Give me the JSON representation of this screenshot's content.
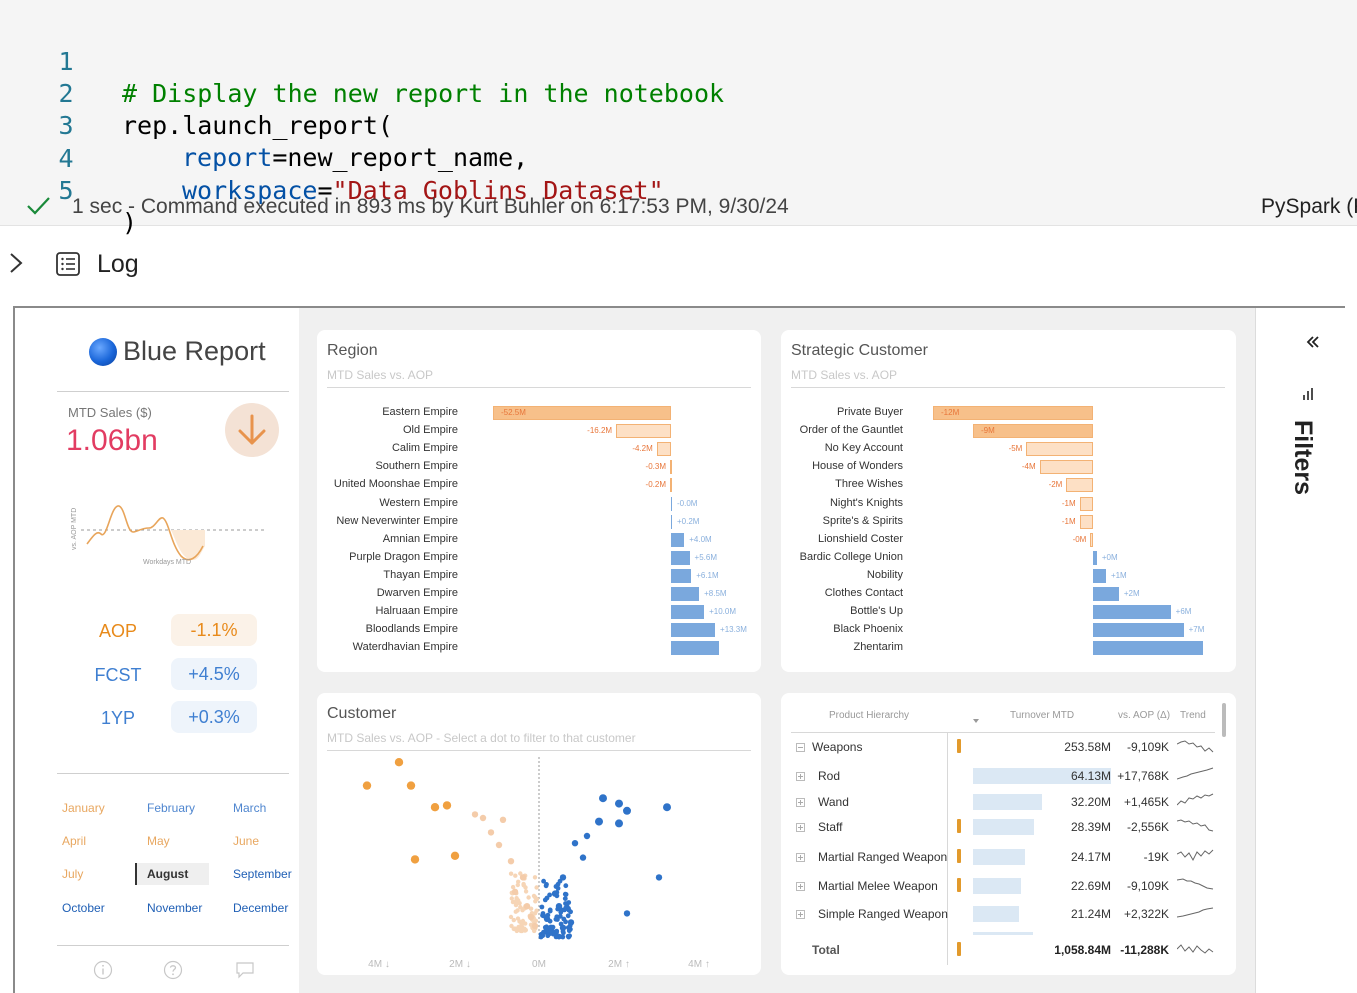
{
  "code_cell": {
    "lines": [
      {
        "num": "1",
        "comment": "# Display the new report in the notebook"
      },
      {
        "num": "2",
        "code": "rep.launch_report("
      },
      {
        "num": "3",
        "param": "report",
        "eq": "=",
        "value": "new_report_name,"
      },
      {
        "num": "4",
        "param": "workspace",
        "eq": "=",
        "str": "\"Data Goblins Dataset\""
      },
      {
        "num": "5",
        "code": ")"
      }
    ],
    "status": "1 sec - Command executed in 893 ms by Kurt Buhler on 6:17:53 PM, 9/30/24",
    "kernel": "PySpark (P",
    "log_label": "Log"
  },
  "report": {
    "title": "Blue Report",
    "mtd_label": "MTD Sales ($)",
    "mtd_value": "1.06bn",
    "spark_y_label": "vs. AOP MTD",
    "spark_x_label": "Workdays MTD",
    "kpis": [
      {
        "label": "AOP",
        "value": "-1.1%",
        "color": "#e88a1a",
        "bg": "#fbf2e8"
      },
      {
        "label": "FCST",
        "value": "+4.5%",
        "color": "#3f7fd1",
        "bg": "#eef4fb"
      },
      {
        "label": "1YP",
        "value": "+0.3%",
        "color": "#3f7fd1",
        "bg": "#eef4fb"
      }
    ],
    "months": [
      {
        "name": "January",
        "color": "#e8a760"
      },
      {
        "name": "February",
        "color": "#4f86cf"
      },
      {
        "name": "March",
        "color": "#4f86cf"
      },
      {
        "name": "April",
        "color": "#e8a760"
      },
      {
        "name": "May",
        "color": "#e8a760"
      },
      {
        "name": "June",
        "color": "#e8a760"
      },
      {
        "name": "July",
        "color": "#e8a760"
      },
      {
        "name": "August",
        "color": "#333333"
      },
      {
        "name": "September",
        "color": "#1f5fb5"
      },
      {
        "name": "October",
        "color": "#1f5fb5"
      },
      {
        "name": "November",
        "color": "#1f5fb5"
      },
      {
        "name": "December",
        "color": "#1f5fb5"
      }
    ],
    "selected_month": "August",
    "footer_icons": [
      "info-icon",
      "help-icon",
      "comment-icon"
    ]
  },
  "region_card": {
    "title": "Region",
    "subtitle": "MTD Sales vs. AOP"
  },
  "strategic_card": {
    "title": "Strategic Customer",
    "subtitle": "MTD Sales vs. AOP"
  },
  "customer_card": {
    "title": "Customer",
    "subtitle": "MTD Sales vs. AOP - Select a dot to filter to that customer"
  },
  "table": {
    "headers": {
      "hierarchy": "Product Hierarchy",
      "turnover": "Turnover MTD",
      "vs_aop": "vs. AOP (Δ)",
      "trend": "Trend"
    },
    "rows": [
      {
        "name": "Weapons",
        "turnover": "253.58M",
        "vs_aop": "-9,109K",
        "expand": "minus",
        "warn": true,
        "share": null
      },
      {
        "name": "Rod",
        "turnover": "64.13M",
        "vs_aop": "+17,768K",
        "expand": "plus",
        "warn": false,
        "share": 1.0
      },
      {
        "name": "Wand",
        "turnover": "32.20M",
        "vs_aop": "+1,465K",
        "expand": "plus",
        "warn": false,
        "share": 0.5
      },
      {
        "name": "Staff",
        "turnover": "28.39M",
        "vs_aop": "-2,556K",
        "expand": "plus",
        "warn": true,
        "share": 0.44
      },
      {
        "name": "Martial Ranged Weapon",
        "turnover": "24.17M",
        "vs_aop": "-19K",
        "expand": "plus",
        "warn": true,
        "share": 0.38
      },
      {
        "name": "Martial Melee Weapon",
        "turnover": "22.69M",
        "vs_aop": "-9,109K",
        "expand": "plus",
        "warn": true,
        "share": 0.35
      },
      {
        "name": "Simple Ranged Weapon",
        "turnover": "21.24M",
        "vs_aop": "+2,322K",
        "expand": "plus",
        "warn": false,
        "share": 0.33
      }
    ],
    "total": {
      "name": "Total",
      "turnover": "1,058.84M",
      "vs_aop": "-11,288K",
      "warn": true
    }
  },
  "filters_label": "Filters",
  "colors": {
    "negative": "#f7c08a",
    "negative_light": "#fde0c5",
    "positive": "#7aa8dd",
    "negative_text": "#e8763a",
    "positive_text": "#8ab0dd"
  },
  "chart_data": [
    {
      "type": "bar",
      "title": "Region",
      "subtitle": "MTD Sales vs. AOP",
      "categories": [
        "Eastern Empire",
        "Old Empire",
        "Calim Empire",
        "Southern Empire",
        "United Moonshae Empire",
        "Western Empire",
        "New Neverwinter Empire",
        "Amnian Empire",
        "Purple Dragon Empire",
        "Thayan Empire",
        "Dwarven Empire",
        "Halruaan Empire",
        "Bloodlands Empire",
        "Waterdhavian Empire"
      ],
      "values": [
        -52.5,
        -16.2,
        -4.2,
        -0.3,
        -0.2,
        -0.0,
        0.2,
        4.0,
        5.6,
        6.1,
        8.5,
        10.0,
        13.3,
        14.5
      ],
      "labels": [
        "-52.5M",
        "-16.2M",
        "-4.2M",
        "-0.3M",
        "-0.2M",
        "-0.0M",
        "+0.2M",
        "+4.0M",
        "+5.6M",
        "+6.1M",
        "+8.5M",
        "+10.0M",
        "+13.3M",
        ""
      ],
      "orientation": "horizontal"
    },
    {
      "type": "bar",
      "title": "Strategic Customer",
      "subtitle": "MTD Sales vs. AOP",
      "categories": [
        "Private Buyer",
        "Order of the Gauntlet",
        "No Key Account",
        "House of Wonders",
        "Three Wishes",
        "Night's Knights",
        "Sprite's & Spirits",
        "Lionshield Coster",
        "Bardic College Union",
        "Nobility",
        "Clothes Contact",
        "Bottle's Up",
        "Black Phoenix",
        "Zhentarim"
      ],
      "values": [
        -12,
        -9,
        -5,
        -4,
        -2,
        -1,
        -1,
        -0.2,
        0.3,
        1,
        2,
        6,
        7,
        8.5
      ],
      "labels": [
        "-12M",
        "-9M",
        "-5M",
        "-4M",
        "-2M",
        "-1M",
        "-1M",
        "-0M",
        "+0M",
        "+1M",
        "+2M",
        "+6M",
        "+7M",
        ""
      ],
      "orientation": "horizontal"
    },
    {
      "type": "scatter",
      "title": "Customer",
      "subtitle": "MTD Sales vs. AOP - Select a dot to filter to that customer",
      "x_ticks": [
        "4M ↓",
        "2M ↓",
        "0M",
        "2M ↑",
        "4M ↑"
      ],
      "xlim": [
        -5,
        5
      ],
      "ylim": [
        0,
        10
      ],
      "orange_points": [
        [
          -3.5,
          9.6
        ],
        [
          -4.3,
          8.3
        ],
        [
          -3.2,
          8.3
        ],
        [
          -2.6,
          7.1
        ],
        [
          -2.3,
          7.2
        ],
        [
          -3.1,
          4.2
        ],
        [
          -2.1,
          4.4
        ],
        [
          -1.6,
          6.7
        ],
        [
          -1.4,
          6.5
        ],
        [
          -0.9,
          6.4
        ],
        [
          -1.2,
          5.7
        ],
        [
          -1.0,
          5.0
        ],
        [
          -0.7,
          4.1
        ],
        [
          -0.4,
          3.2
        ],
        [
          -0.6,
          2.4
        ],
        [
          -0.3,
          1.6
        ],
        [
          -0.2,
          1.0
        ],
        [
          -0.1,
          0.5
        ]
      ],
      "blue_points": [
        [
          1.4,
          10.4
        ],
        [
          2.6,
          10.6
        ],
        [
          1.5,
          6.3
        ],
        [
          1.6,
          7.6
        ],
        [
          2.0,
          7.3
        ],
        [
          2.0,
          6.2
        ],
        [
          2.2,
          6.9
        ],
        [
          3.2,
          7.1
        ],
        [
          1.2,
          5.5
        ],
        [
          0.9,
          5.1
        ],
        [
          3.0,
          3.2
        ],
        [
          2.2,
          1.2
        ],
        [
          0.6,
          3.2
        ],
        [
          0.5,
          1.6
        ],
        [
          1.1,
          4.3
        ],
        [
          0.4,
          2.3
        ],
        [
          0.8,
          0.7
        ],
        [
          0.3,
          0.4
        ],
        [
          0.2,
          0.9
        ],
        [
          0.6,
          0.4
        ]
      ]
    }
  ]
}
